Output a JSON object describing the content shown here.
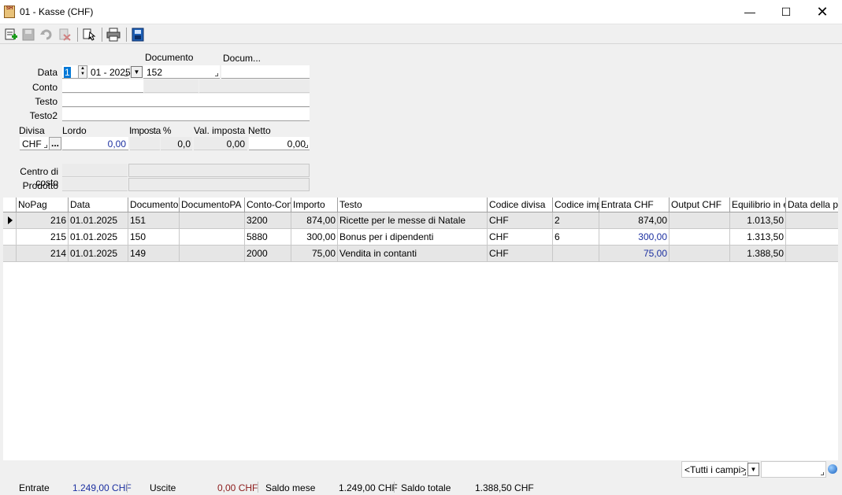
{
  "window": {
    "app_icon_text": "SH",
    "title": "01 - Kasse (CHF)",
    "minimize_glyph": "—",
    "maximize_glyph": "☐",
    "close_glyph": "✕"
  },
  "toolbar": {
    "icons": [
      "new-record-icon",
      "save-icon",
      "undo-icon",
      "delete-icon",
      "search-record-icon",
      "print-icon",
      "calculator-icon"
    ]
  },
  "form": {
    "documento_header": "Documento",
    "docum_header": "Docum...",
    "data_label": "Data",
    "data_day": "1",
    "data_month_year": "01 - 2025",
    "documento_value": "152",
    "docum_value": "",
    "conto_label": "Conto",
    "testo_label": "Testo",
    "testo2_label": "Testo2",
    "divisa_label": "Divisa",
    "lordo_label": "Lordo",
    "imposta_label": "Imposta %",
    "val_imposta_label": "Val. imposta",
    "netto_label": "Netto",
    "divisa_value": "CHF",
    "lordo_value": "0,00",
    "imposta_value": "0,0",
    "val_imposta_value": "0,00",
    "netto_value": "0,00",
    "ellipsis_label": "...",
    "centro_label": "Centro di costo",
    "prodotto_label": "Prodotto"
  },
  "grid": {
    "columns": [
      "NoPag",
      "Data",
      "Documento",
      "DocumentoPA",
      "Conto-Conta",
      "Importo",
      "Testo",
      "Codice divisa",
      "Codice impo",
      "Entrata CHF",
      "Output CHF",
      "Equilibrio in ese",
      "Data della pre"
    ],
    "rows": [
      {
        "nopag": "216",
        "data": "01.01.2025",
        "documento": "151",
        "documentopa": "",
        "conto": "3200",
        "importo": "874,00",
        "testo": "Ricette per le messe di Natale",
        "codice_divisa": "CHF",
        "codice_imposta": "2",
        "entrata": "874,00",
        "output": "",
        "equilibrio": "1.013,50",
        "data_pre": ""
      },
      {
        "nopag": "215",
        "data": "01.01.2025",
        "documento": "150",
        "documentopa": "",
        "conto": "5880",
        "importo": "300,00",
        "testo": "Bonus per i dipendenti",
        "codice_divisa": "CHF",
        "codice_imposta": "6",
        "entrata": "300,00",
        "output": "",
        "equilibrio": "1.313,50",
        "data_pre": ""
      },
      {
        "nopag": "214",
        "data": "01.01.2025",
        "documento": "149",
        "documentopa": "",
        "conto": "2000",
        "importo": "75,00",
        "testo": "Vendita in contanti",
        "codice_divisa": "CHF",
        "codice_imposta": "",
        "entrata": "75,00",
        "output": "",
        "equilibrio": "1.388,50",
        "data_pre": ""
      }
    ]
  },
  "filter": {
    "field_value": "<Tutti i campi>",
    "search_value": ""
  },
  "status": {
    "entrate_label": "Entrate",
    "entrate_value": "1.249,00 CHF",
    "uscite_label": "Uscite",
    "uscite_value": "0,00 CHF",
    "saldo_mese_label": "Saldo mese",
    "saldo_mese_value": "1.249,00 CHF",
    "saldo_totale_label": "Saldo totale",
    "saldo_totale_value": "1.388,50 CHF"
  },
  "colors": {
    "accent_blue": "#1b2fa0",
    "negative_red": "#8b1a1a"
  }
}
